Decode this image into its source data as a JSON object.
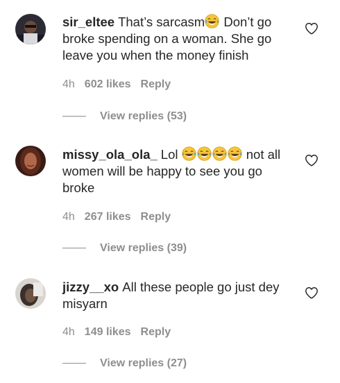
{
  "comments": [
    {
      "username": "sir_eltee",
      "text_before": "That’s sarcasm",
      "emoji_count": 1,
      "text_after": " Don’t go broke spending on a woman. She go leave you when the money finish",
      "time": "4h",
      "likes": "602 likes",
      "reply": "Reply",
      "view_replies": "View replies (53)"
    },
    {
      "username": "missy_ola_ola_",
      "text_before": "Lol ",
      "emoji_count": 4,
      "text_after": " not all women will be happy to see you go broke",
      "time": "4h",
      "likes": "267 likes",
      "reply": "Reply",
      "view_replies": "View replies (39)"
    },
    {
      "username": "jizzy__xo",
      "text_before": "All these people go just dey misyarn",
      "emoji_count": 0,
      "text_after": "",
      "time": "4h",
      "likes": "149 likes",
      "reply": "Reply",
      "view_replies": "View replies (27)"
    }
  ],
  "icons": {
    "emoji": "face-with-tears-of-joy-icon",
    "like": "heart-outline-icon"
  },
  "colors": {
    "text": "#262626",
    "muted": "#8e8e8e"
  }
}
